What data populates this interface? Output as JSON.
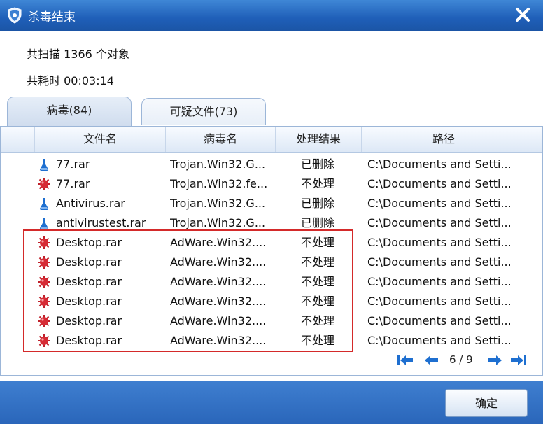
{
  "window": {
    "title": "杀毒结束"
  },
  "summary": {
    "scanned": "共扫描 1366 个对象",
    "elapsed": "共耗时 00:03:14"
  },
  "tabs": [
    {
      "label": "病毒(84)",
      "active": true
    },
    {
      "label": "可疑文件(73)",
      "active": false
    }
  ],
  "columns": [
    "文件名",
    "病毒名",
    "处理结果",
    "路径"
  ],
  "rows": [
    {
      "icon": "flask-icon",
      "file": "77.rar",
      "virus": "Trojan.Win32.G...",
      "result": "已删除",
      "path": "C:\\Documents and Setti..."
    },
    {
      "icon": "virus-icon",
      "file": "77.rar",
      "virus": "Trojan.Win32.fe...",
      "result": "不处理",
      "path": "C:\\Documents and Setti..."
    },
    {
      "icon": "flask-icon",
      "file": "Antivirus.rar",
      "virus": "Trojan.Win32.G...",
      "result": "已删除",
      "path": "C:\\Documents and Setti..."
    },
    {
      "icon": "flask-icon",
      "file": "antivirustest.rar",
      "virus": "Trojan.Win32.G...",
      "result": "已删除",
      "path": "C:\\Documents and Setti..."
    },
    {
      "icon": "virus-icon",
      "file": "Desktop.rar",
      "virus": "AdWare.Win32....",
      "result": "不处理",
      "path": "C:\\Documents and Setti..."
    },
    {
      "icon": "virus-icon",
      "file": "Desktop.rar",
      "virus": "AdWare.Win32....",
      "result": "不处理",
      "path": "C:\\Documents and Setti..."
    },
    {
      "icon": "virus-icon",
      "file": "Desktop.rar",
      "virus": "AdWare.Win32....",
      "result": "不处理",
      "path": "C:\\Documents and Setti..."
    },
    {
      "icon": "virus-icon",
      "file": "Desktop.rar",
      "virus": "AdWare.Win32....",
      "result": "不处理",
      "path": "C:\\Documents and Setti..."
    },
    {
      "icon": "virus-icon",
      "file": "Desktop.rar",
      "virus": "AdWare.Win32....",
      "result": "不处理",
      "path": "C:\\Documents and Setti..."
    },
    {
      "icon": "virus-icon",
      "file": "Desktop.rar",
      "virus": "AdWare.Win32....",
      "result": "不处理",
      "path": "C:\\Documents and Setti..."
    }
  ],
  "pager": {
    "text": "6 / 9"
  },
  "buttons": {
    "ok": "确定"
  },
  "colors": {
    "titlebar": "#1f5fb8",
    "highlight": "#d42a2a",
    "virus": "#c0202a",
    "flask": "#1e6fd0"
  }
}
